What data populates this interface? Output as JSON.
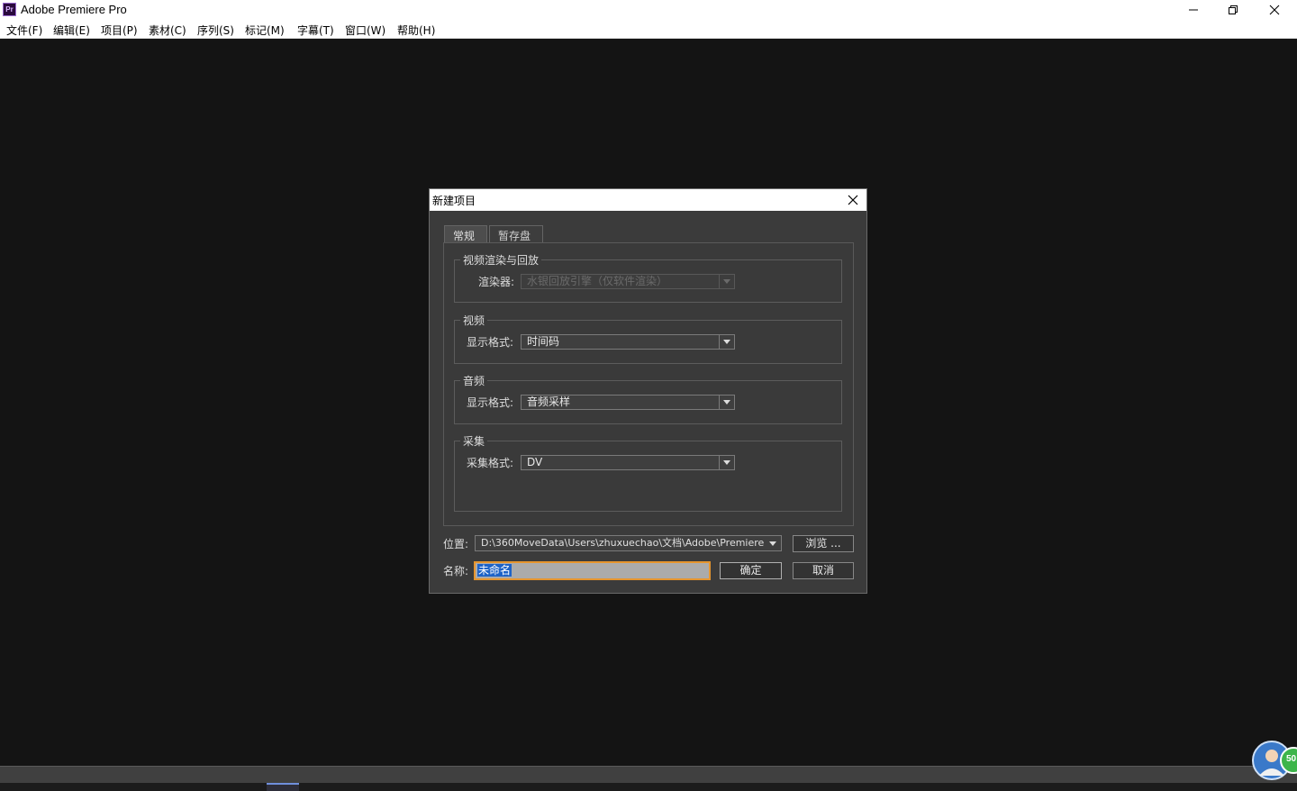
{
  "window": {
    "title": "Adobe Premiere Pro",
    "icon_text": "Pr"
  },
  "menu": [
    "文件(F)",
    "编辑(E)",
    "项目(P)",
    "素材(C)",
    "序列(S)",
    "标记(M)",
    "字幕(T)",
    "窗口(W)",
    "帮助(H)"
  ],
  "dialog": {
    "title": "新建项目",
    "tabs": [
      "常规",
      "暂存盘"
    ],
    "active_tab": "常规",
    "groups": {
      "render": {
        "legend": "视频渲染与回放",
        "label": "渲染器:",
        "value": "水银回放引擎（仅软件渲染）",
        "enabled": false
      },
      "video": {
        "legend": "视频",
        "label": "显示格式:",
        "value": "时间码"
      },
      "audio": {
        "legend": "音频",
        "label": "显示格式:",
        "value": "音频采样"
      },
      "capture": {
        "legend": "采集",
        "label": "采集格式:",
        "value": "DV"
      }
    },
    "location": {
      "label": "位置:",
      "value": "D:\\360MoveData\\Users\\zhuxuechao\\文档\\Adobe\\Premiere P..."
    },
    "name": {
      "label": "名称:",
      "value": "未命名"
    },
    "buttons": {
      "browse": "浏览 ...",
      "ok": "确定",
      "cancel": "取消"
    }
  },
  "float_widget": {
    "badge_text": "50",
    "badge_color": "#3db54a"
  },
  "colors": {
    "workspace_bg": "#141414",
    "dialog_bg": "#3b3b3b",
    "input_focus": "#e6952e",
    "selection": "#1e63c7"
  }
}
